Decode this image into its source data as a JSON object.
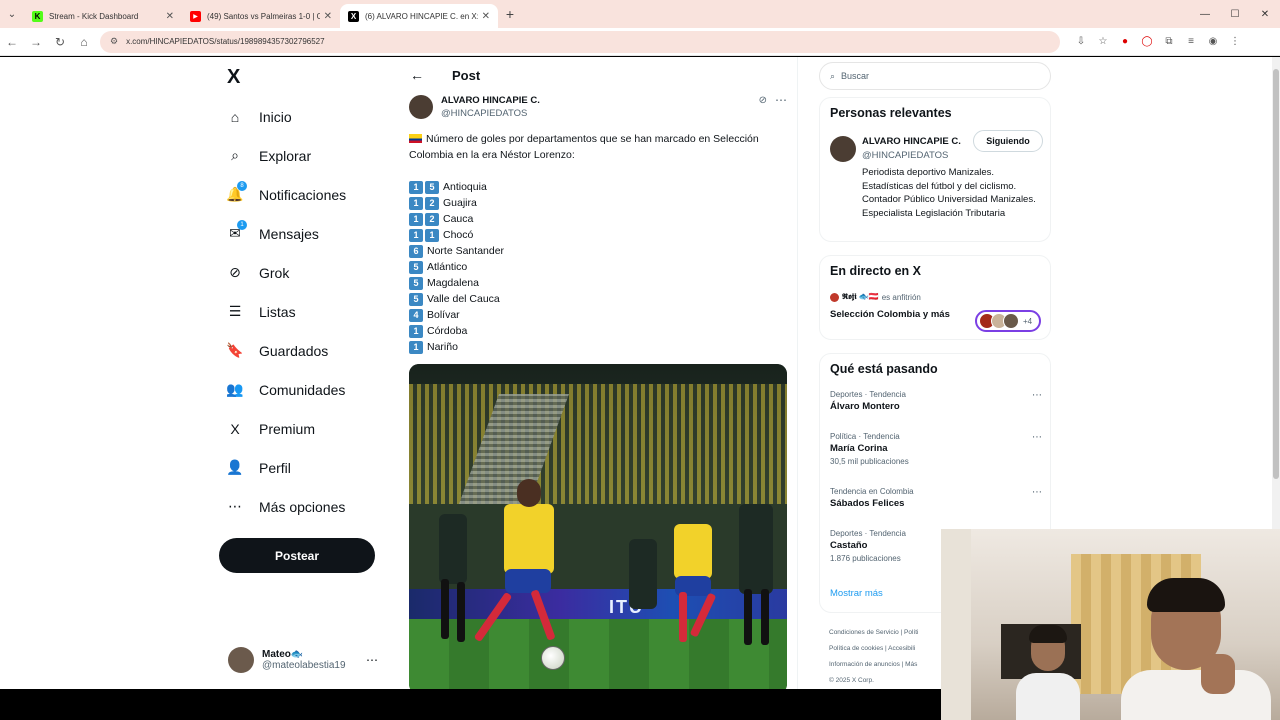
{
  "browser": {
    "tabs": [
      {
        "title": "Stream - Kick Dashboard",
        "icon": "kick-icon",
        "color": "#53fc18",
        "letter": "K"
      },
      {
        "title": "(49) Santos vs Palmeiras 1-0 | G",
        "icon": "youtube-icon",
        "color": "#ff0000",
        "letter": "▶"
      },
      {
        "title": "(6) ALVARO HINCAPIE C. en X: ",
        "icon": "x-icon",
        "color": "#000000",
        "letter": "X"
      }
    ],
    "url": "x.com/HINCAPIEDATOS/status/1989894357302796527"
  },
  "nav": {
    "logo": "X",
    "items": [
      {
        "label": "Inicio",
        "icon": "home-icon",
        "glyph": "⌂"
      },
      {
        "label": "Explorar",
        "icon": "search-icon",
        "glyph": "⌕"
      },
      {
        "label": "Notificaciones",
        "icon": "bell-icon",
        "glyph": "🔔",
        "badge": "8"
      },
      {
        "label": "Mensajes",
        "icon": "mail-icon",
        "glyph": "✉",
        "badge": "1"
      },
      {
        "label": "Grok",
        "icon": "grok-icon",
        "glyph": "⊘"
      },
      {
        "label": "Listas",
        "icon": "list-icon",
        "glyph": "☰"
      },
      {
        "label": "Guardados",
        "icon": "bookmark-icon",
        "glyph": "🔖"
      },
      {
        "label": "Comunidades",
        "icon": "communities-icon",
        "glyph": "👥"
      },
      {
        "label": "Premium",
        "icon": "x-premium-icon",
        "glyph": "X"
      },
      {
        "label": "Perfil",
        "icon": "profile-icon",
        "glyph": "👤"
      },
      {
        "label": "Más opciones",
        "icon": "more-options-icon",
        "glyph": "⋯"
      }
    ],
    "post_button": "Postear",
    "account": {
      "name": "Mateo🐟",
      "handle": "@mateolabestia19"
    }
  },
  "post": {
    "header": "Post",
    "author_name": "ALVARO HINCAPIE C.",
    "author_handle": "@HINCAPIEDATOS",
    "intro": "Número de goles por departamentos que se han marcado en Selección Colombia en la era Néstor Lorenzo:",
    "goals": [
      {
        "digits": [
          "1",
          "5"
        ],
        "dept": "Antioquia"
      },
      {
        "digits": [
          "1",
          "2"
        ],
        "dept": "Guajira"
      },
      {
        "digits": [
          "1",
          "2"
        ],
        "dept": "Cauca"
      },
      {
        "digits": [
          "1",
          "1"
        ],
        "dept": "Chocó"
      },
      {
        "digits": [
          "6"
        ],
        "dept": "Norte Santander"
      },
      {
        "digits": [
          "5"
        ],
        "dept": "Atlántico"
      },
      {
        "digits": [
          "5"
        ],
        "dept": "Magdalena"
      },
      {
        "digits": [
          "5"
        ],
        "dept": "Valle del Cauca"
      },
      {
        "digits": [
          "4"
        ],
        "dept": "Bolívar"
      },
      {
        "digits": [
          "1"
        ],
        "dept": "Córdoba"
      },
      {
        "digits": [
          "1"
        ],
        "dept": "Nariño"
      }
    ],
    "photo_board_text": "ITU"
  },
  "sidebar": {
    "search_placeholder": "Buscar",
    "relevant": {
      "title": "Personas relevantes",
      "name": "ALVARO HINCAPIE C.",
      "handle": "@HINCAPIEDATOS",
      "button": "Siguiendo",
      "bio": "Periodista deportivo Manizales. Estadísticas del fútbol y del ciclismo. Contador Público Universidad Manizales. Especialista Legislación Tributaria"
    },
    "live": {
      "title": "En directo en X",
      "host": "𝕽𝖔𝖏𝖎 🐟🇦🇹",
      "host_suffix": "es anfitrión",
      "space_title": "Selección Colombia y más",
      "extra_count": "+4"
    },
    "trends": {
      "title": "Qué está pasando",
      "items": [
        {
          "category": "Deportes · Tendencia",
          "name": "Álvaro Montero",
          "count": ""
        },
        {
          "category": "Política · Tendencia",
          "name": "María Corina",
          "count": "30,5 mil publicaciones"
        },
        {
          "category": "Tendencia en Colombia",
          "name": "Sábados Felices",
          "count": ""
        },
        {
          "category": "Deportes · Tendencia",
          "name": "Castaño",
          "count": "1.876 publicaciones"
        }
      ],
      "show_more": "Mostrar más"
    },
    "footer": [
      "Condiciones de Servicio  |  Políti",
      "Política de cookies  |  Accesibili",
      "Información de anuncios  |  Más",
      "© 2025 X Corp."
    ]
  }
}
